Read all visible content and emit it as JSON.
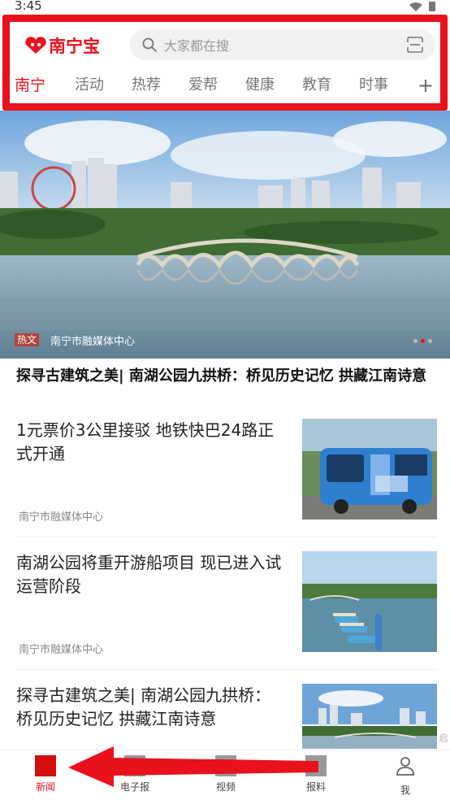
{
  "status": {
    "time": "3:45"
  },
  "header": {
    "logo_text": "南宁宝",
    "search_placeholder": "大家都在搜",
    "tabs": [
      "南宁",
      "活动",
      "热荐",
      "爱帮",
      "健康",
      "教育",
      "时事"
    ],
    "active_tab": "南宁",
    "plus": "+"
  },
  "banner": {
    "tag": "热文",
    "source": "南宁市融媒体中心",
    "slide_count": 3,
    "active_slide": 2
  },
  "headline": "探寻古建筑之美| 南湖公园九拱桥：桥见历史记忆 拱藏江南诗意",
  "news": [
    {
      "title": "1元票价3公里接驳  地铁快巴24路正式开通",
      "source": "南宁市融媒体中心"
    },
    {
      "title": "南湖公园将重开游船项目  现已进入试运营阶段",
      "source": "南宁市融媒体中心"
    },
    {
      "title": " 探寻古建筑之美| 南湖公园九拱桥：桥见历史记忆 拱藏江南诗意",
      "source": ""
    }
  ],
  "bottom_nav": [
    {
      "label": "新闻",
      "active": true
    },
    {
      "label": "电子报",
      "active": false
    },
    {
      "label": "视频",
      "active": false
    },
    {
      "label": "报料",
      "active": false
    },
    {
      "label": "我",
      "active": false
    }
  ],
  "side_text": "启 移",
  "colors": {
    "accent": "#e8111c"
  }
}
